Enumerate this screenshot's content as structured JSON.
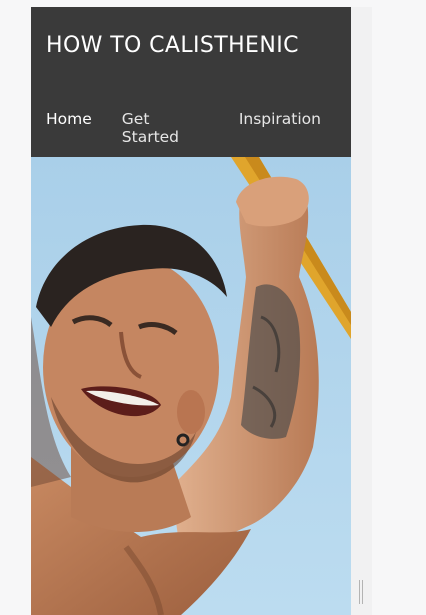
{
  "site": {
    "title": "HOW TO CALISTHENIC"
  },
  "nav": {
    "items": [
      {
        "label": "Home",
        "active": true
      },
      {
        "label": "Get Started",
        "active": false
      },
      {
        "label": "Inspiration",
        "active": false
      }
    ]
  },
  "colors": {
    "header_bg": "#3a3a3a",
    "sky": "#9ec8e6",
    "bar": "#e3a82a"
  }
}
